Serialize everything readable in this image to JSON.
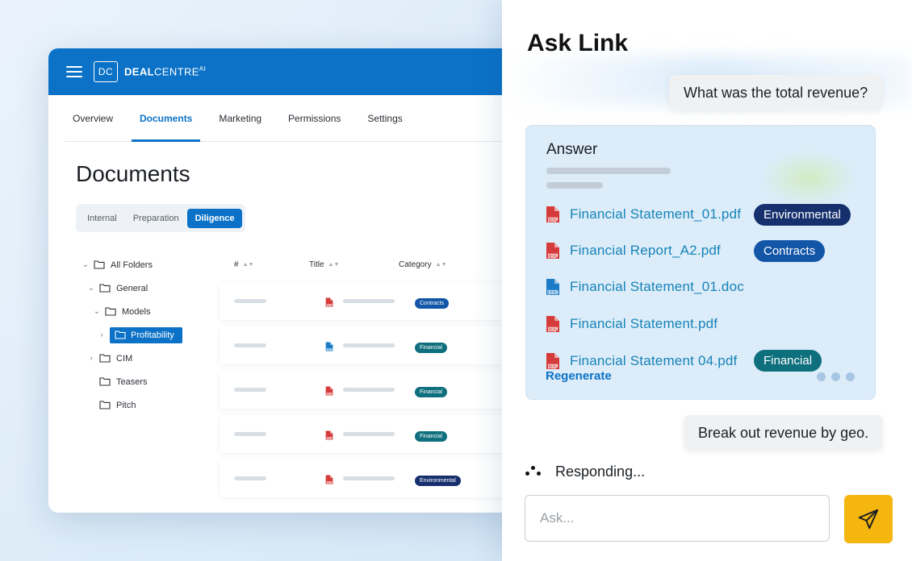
{
  "app": {
    "logo_mark": "DC",
    "logo_bold": "DEAL",
    "logo_rest": "CENTRE",
    "logo_sup": "AI",
    "tabs": [
      {
        "label": "Overview"
      },
      {
        "label": "Documents"
      },
      {
        "label": "Marketing"
      },
      {
        "label": "Permissions"
      },
      {
        "label": "Settings"
      }
    ],
    "active_tab": "Documents",
    "page_title": "Documents",
    "segments": [
      {
        "label": "Internal"
      },
      {
        "label": "Preparation"
      },
      {
        "label": "Diligence"
      }
    ],
    "active_segment": "Diligence",
    "tree": [
      {
        "label": "All Folders",
        "chevron": "down"
      },
      {
        "label": "General",
        "chevron": "down"
      },
      {
        "label": "Models",
        "chevron": "down"
      },
      {
        "label": "Profitability",
        "chevron": "right",
        "selected": true
      },
      {
        "label": "CIM",
        "chevron": "right"
      },
      {
        "label": "Teasers",
        "chevron": ""
      },
      {
        "label": "Pitch",
        "chevron": ""
      }
    ],
    "table": {
      "columns": [
        {
          "label": "#"
        },
        {
          "label": "Title"
        },
        {
          "label": "Category"
        }
      ],
      "rows": [
        {
          "file_type": "pdf",
          "category": "Contracts"
        },
        {
          "file_type": "doc",
          "category": "Financial"
        },
        {
          "file_type": "pdf",
          "category": "Financial"
        },
        {
          "file_type": "pdf",
          "category": "Financial"
        },
        {
          "file_type": "pdf",
          "category": "Environmental"
        }
      ]
    }
  },
  "chat": {
    "title": "Ask Link",
    "user_message_1": "What was the total revenue?",
    "answer_title": "Answer",
    "files": [
      {
        "name": "Financial Statement_01.pdf",
        "type": "pdf",
        "tag": "Environmental"
      },
      {
        "name": "Financial Report_A2.pdf",
        "type": "pdf",
        "tag": "Contracts"
      },
      {
        "name": "Financial Statement_01.doc",
        "type": "doc",
        "tag": ""
      },
      {
        "name": "Financial Statement.pdf",
        "type": "pdf",
        "tag": ""
      },
      {
        "name": "Financial  Statement 04.pdf",
        "type": "pdf",
        "tag": "Financial"
      }
    ],
    "regenerate_label": "Regenerate",
    "user_message_2": "Break out revenue by geo.",
    "responding_label": "Responding...",
    "input_placeholder": "Ask...",
    "send_icon": "send-icon"
  },
  "colors": {
    "brand_blue": "#0b72c7",
    "contracts": "#1356a8",
    "financial": "#0e6f7d",
    "environmental": "#16306e",
    "pdf_red": "#d63b3b",
    "doc_blue": "#1a7cc6",
    "send_button": "#f5b70f"
  }
}
